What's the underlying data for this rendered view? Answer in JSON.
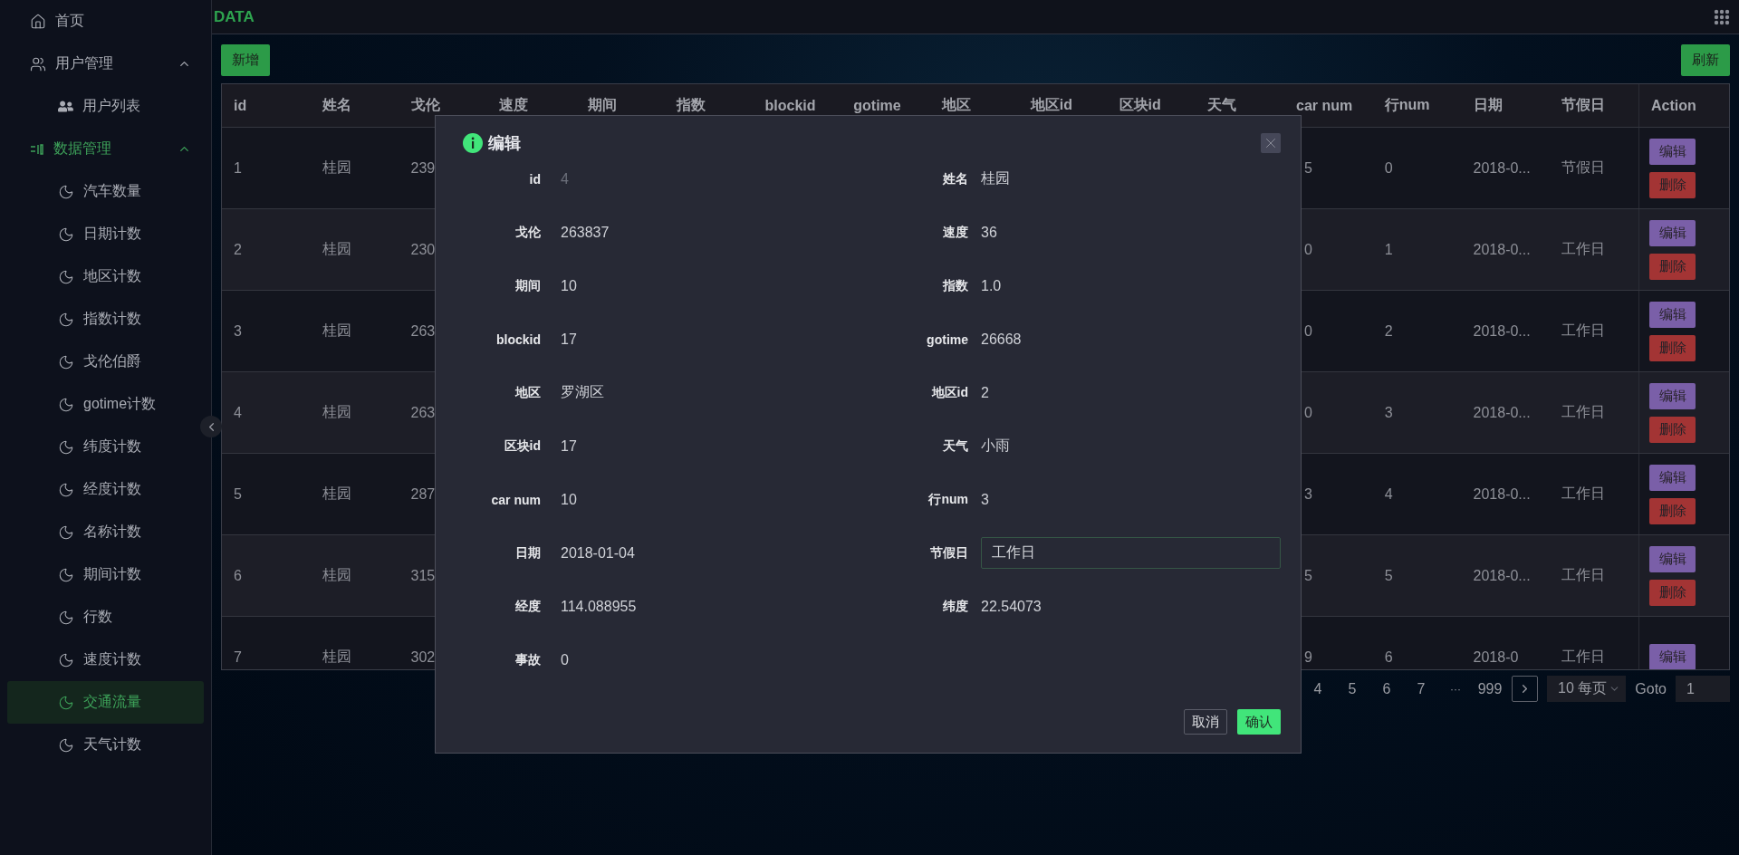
{
  "sidebar": {
    "items": [
      {
        "label": "首页",
        "selected": false
      },
      {
        "label": "用户管理",
        "expanded": true,
        "selected": false,
        "children": [
          {
            "label": "用户列表",
            "selected": false
          }
        ]
      },
      {
        "label": "数据管理",
        "expanded": true,
        "selected": false,
        "children": [
          {
            "label": "汽车数量",
            "selected": false
          },
          {
            "label": "日期计数",
            "selected": false
          },
          {
            "label": "地区计数",
            "selected": false
          },
          {
            "label": "指数计数",
            "selected": false
          },
          {
            "label": "戈伦伯爵",
            "selected": false
          },
          {
            "label": "gotime计数",
            "selected": false
          },
          {
            "label": "纬度计数",
            "selected": false
          },
          {
            "label": "经度计数",
            "selected": false
          },
          {
            "label": "名称计数",
            "selected": false
          },
          {
            "label": "期间计数",
            "selected": false
          },
          {
            "label": "行数",
            "selected": false
          },
          {
            "label": "速度计数",
            "selected": false
          },
          {
            "label": "交通流量",
            "selected": true
          },
          {
            "label": "天气计数",
            "selected": false
          }
        ]
      }
    ]
  },
  "header": {
    "title": "DATA"
  },
  "toolbar": {
    "add_button": "新增",
    "refresh_button": "刷新"
  },
  "table": {
    "columns": [
      "id",
      "姓名",
      "戈伦",
      "速度",
      "期间",
      "指数",
      "blockid",
      "gotime",
      "地区",
      "地区id",
      "区块id",
      "天气",
      "car num",
      "行num",
      "日期",
      "节假日",
      "Action"
    ],
    "rows": [
      {
        "id": "1",
        "name": "桂园",
        "gallon": "239",
        "car_num": "5",
        "row_num": "0",
        "date": "2018-0...",
        "holiday": "节假日",
        "actions": [
          "编辑",
          "删除"
        ]
      },
      {
        "id": "2",
        "name": "桂园",
        "gallon": "230",
        "car_num": "0",
        "row_num": "1",
        "date": "2018-0...",
        "holiday": "工作日",
        "actions": [
          "编辑",
          "删除"
        ]
      },
      {
        "id": "3",
        "name": "桂园",
        "gallon": "263",
        "car_num": "0",
        "row_num": "2",
        "date": "2018-0...",
        "holiday": "工作日",
        "actions": [
          "编辑",
          "删除"
        ]
      },
      {
        "id": "4",
        "name": "桂园",
        "gallon": "263",
        "car_num": "0",
        "row_num": "3",
        "date": "2018-0...",
        "holiday": "工作日",
        "actions": [
          "编辑",
          "删除"
        ]
      },
      {
        "id": "5",
        "name": "桂园",
        "gallon": "287",
        "car_num": "3",
        "row_num": "4",
        "date": "2018-0...",
        "holiday": "工作日",
        "actions": [
          "编辑",
          "删除"
        ]
      },
      {
        "id": "6",
        "name": "桂园",
        "gallon": "315",
        "car_num": "5",
        "row_num": "5",
        "date": "2018-0...",
        "holiday": "工作日",
        "actions": [
          "编辑",
          "删除"
        ]
      },
      {
        "id": "7",
        "name": "桂园",
        "gallon": "302",
        "car_num": "9",
        "row_num": "6",
        "date": "2018-0",
        "holiday": "工作日",
        "actions": [
          "编辑"
        ]
      }
    ]
  },
  "pagination": {
    "pages": [
      {
        "label": "4",
        "kind": "page"
      },
      {
        "label": "5",
        "kind": "page"
      },
      {
        "label": "6",
        "kind": "page"
      },
      {
        "label": "7",
        "kind": "page"
      },
      {
        "label": "···",
        "kind": "ellipsis"
      },
      {
        "label": "999",
        "kind": "page"
      }
    ],
    "page_size": "10 每页",
    "goto_label": "Goto",
    "goto_value": "1"
  },
  "dialog": {
    "title": "编辑",
    "fields": [
      {
        "label": "id",
        "value": "4",
        "kind": "readonly"
      },
      {
        "label": "姓名",
        "value": "桂园",
        "kind": "text"
      },
      {
        "label": "戈伦",
        "value": "263837",
        "kind": "text"
      },
      {
        "label": "速度",
        "value": "36",
        "kind": "text"
      },
      {
        "label": "期间",
        "value": "10",
        "kind": "text"
      },
      {
        "label": "指数",
        "value": "1.0",
        "kind": "text"
      },
      {
        "label": "blockid",
        "value": "17",
        "kind": "text"
      },
      {
        "label": "gotime",
        "value": "26668",
        "kind": "text"
      },
      {
        "label": "地区",
        "value": "罗湖区",
        "kind": "text"
      },
      {
        "label": "地区id",
        "value": "2",
        "kind": "text"
      },
      {
        "label": "区块id",
        "value": "17",
        "kind": "text"
      },
      {
        "label": "天气",
        "value": "小雨",
        "kind": "text"
      },
      {
        "label": "car num",
        "value": "10",
        "kind": "text"
      },
      {
        "label": "行num",
        "value": "3",
        "kind": "text"
      },
      {
        "label": "日期",
        "value": "2018-01-04",
        "kind": "text"
      },
      {
        "label": "节假日",
        "value": "工作日",
        "kind": "input"
      },
      {
        "label": "经度",
        "value": "114.088955",
        "kind": "text"
      },
      {
        "label": "纬度",
        "value": "22.54073",
        "kind": "text"
      },
      {
        "label": "事故",
        "value": "0",
        "kind": "text"
      }
    ],
    "cancel_button": "取消",
    "confirm_button": "确认"
  }
}
